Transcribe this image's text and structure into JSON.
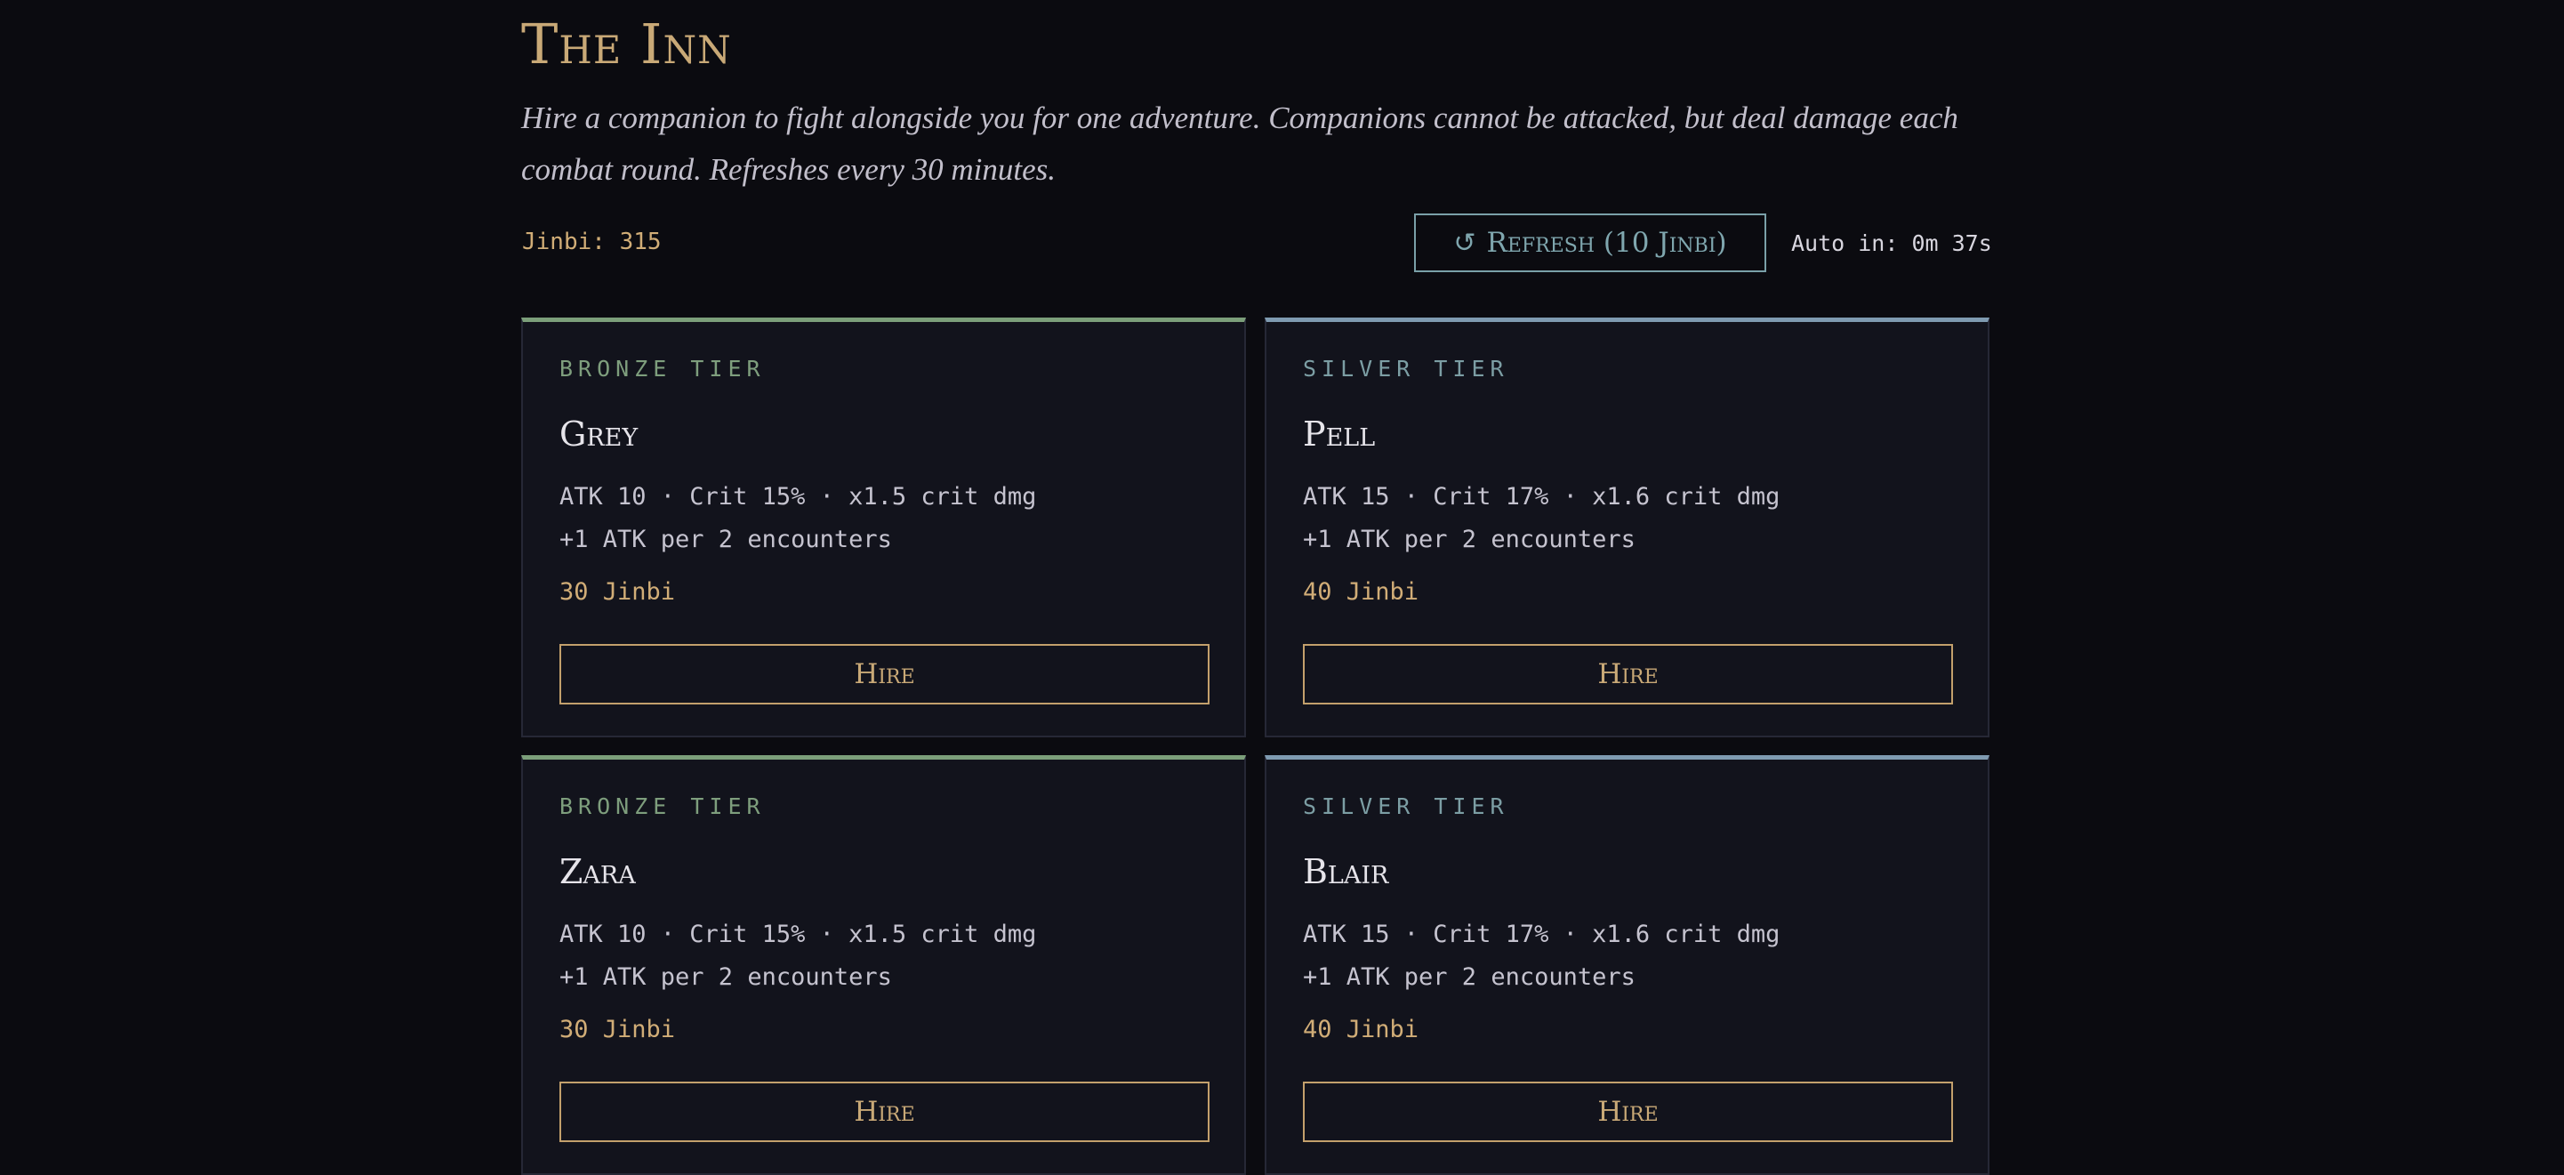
{
  "header": {
    "title": "The Inn",
    "subtitle": "Hire a companion to fight alongside you for one adventure. Companions cannot be attacked, but deal damage each combat round. Refreshes every 30 minutes."
  },
  "toolbar": {
    "jinbi_balance": "Jinbi: 315",
    "refresh_label": "Refresh (10 Jinbi)",
    "refresh_icon": "↺",
    "auto_refresh": "Auto in: 0m 37s"
  },
  "colors": {
    "background": "#0b0b10",
    "card": "#12131c",
    "gold": "#c9a977",
    "bronze_tier": "#7c9f7a",
    "silver_tier": "#7f9bb1"
  },
  "companions": [
    {
      "tier": "BRONZE TIER",
      "name": "Grey",
      "stats": "ATK 10 · Crit 15% · x1.5 crit dmg",
      "growth": "+1 ATK per 2 encounters",
      "price": "30 Jinbi",
      "hire_label": "Hire"
    },
    {
      "tier": "SILVER TIER",
      "name": "Pell",
      "stats": "ATK 15 · Crit 17% · x1.6 crit dmg",
      "growth": "+1 ATK per 2 encounters",
      "price": "40 Jinbi",
      "hire_label": "Hire"
    },
    {
      "tier": "BRONZE TIER",
      "name": "Zara",
      "stats": "ATK 10 · Crit 15% · x1.5 crit dmg",
      "growth": "+1 ATK per 2 encounters",
      "price": "30 Jinbi",
      "hire_label": "Hire"
    },
    {
      "tier": "SILVER TIER",
      "name": "Blair",
      "stats": "ATK 15 · Crit 17% · x1.6 crit dmg",
      "growth": "+1 ATK per 2 encounters",
      "price": "40 Jinbi",
      "hire_label": "Hire"
    }
  ]
}
